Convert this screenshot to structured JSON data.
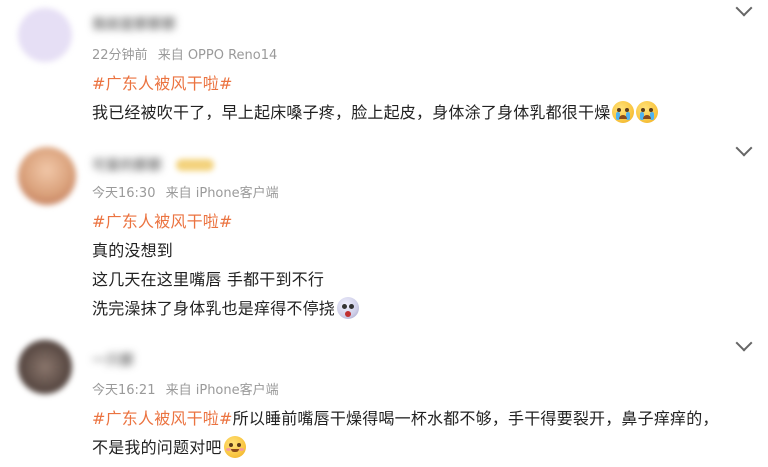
{
  "posts": [
    {
      "username": "我就是那那那",
      "time": "22分钟前",
      "source": "来自 OPPO Reno14",
      "hashtag": "#广东人被风干啦#",
      "lines": [
        "我已经被吹干了，早上起床嗓子疼，脸上起皮，身体涂了身体乳都很干燥"
      ],
      "emojis": [
        "crying-emoji",
        "crying-emoji"
      ],
      "avatar_color": "#e6dff5"
    },
    {
      "username": "可爱的那那",
      "time": "今天16:30",
      "source": "来自 iPhone客户端",
      "hashtag": "#广东人被风干啦#",
      "lines": [
        "真的没想到",
        "这几天在这里嘴唇 手都干到不行",
        "洗完澡抹了身体乳也是痒得不停挠"
      ],
      "emojis": [
        "crazy-emoji"
      ],
      "avatar_color": "#d9a07a"
    },
    {
      "username": "一只那",
      "time": "今天16:21",
      "source": "来自 iPhone客户端",
      "hashtag": "#广东人被风干啦#",
      "text_after_hashtag": "所以睡前嘴唇干燥得喝一杯水都不够，手干得要裂开，鼻子痒痒的，",
      "lines": [
        "不是我的问题对吧"
      ],
      "emojis": [
        "blush-emoji"
      ],
      "avatar_color": "#5a4a44"
    }
  ],
  "icons": {
    "expand": "chevron-down-icon",
    "verified": "vip-badge"
  }
}
